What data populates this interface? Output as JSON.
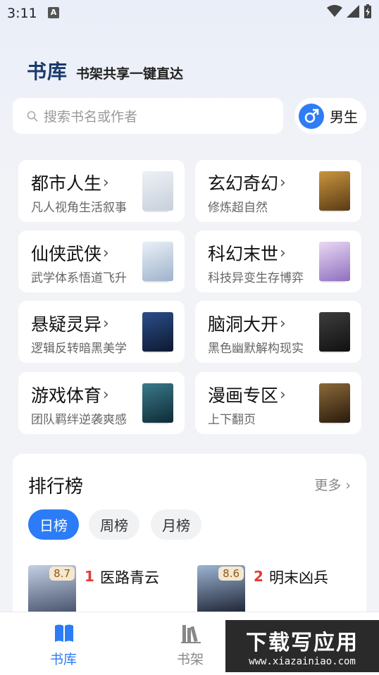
{
  "status": {
    "time": "3:11",
    "notif_icon": "A"
  },
  "header": {
    "title": "书库",
    "subtitle": "书架共享一键直达"
  },
  "search": {
    "placeholder": "搜索书名或作者"
  },
  "gender": {
    "label": "男生",
    "icon": "male-icon"
  },
  "categories": [
    {
      "name": "都市人生",
      "desc": "凡人视角生活叙事",
      "cover_color": "#dde3ea"
    },
    {
      "name": "玄幻奇幻",
      "desc": "修炼超自然",
      "cover_color": "#6a4a26"
    },
    {
      "name": "仙侠武侠",
      "desc": "武学体系悟道飞升",
      "cover_color": "#c9d6e6"
    },
    {
      "name": "科幻末世",
      "desc": "科技异变生存博弈",
      "cover_color": "#b9a6d8"
    },
    {
      "name": "悬疑灵异",
      "desc": "逻辑反转暗黑美学",
      "cover_color": "#1a2a4a"
    },
    {
      "name": "脑洞大开",
      "desc": "黑色幽默解构现实",
      "cover_color": "#2a2a2a"
    },
    {
      "name": "游戏体育",
      "desc": "团队羁绊逆袭爽感",
      "cover_color": "#1f4a5a"
    },
    {
      "name": "漫画专区",
      "desc": "上下翻页",
      "cover_color": "#3a2a1a"
    }
  ],
  "ranking": {
    "title": "排行榜",
    "more": "更多",
    "tabs": [
      {
        "label": "日榜",
        "active": true
      },
      {
        "label": "周榜",
        "active": false
      },
      {
        "label": "月榜",
        "active": false
      }
    ],
    "books": [
      {
        "rank": "1",
        "title": "医路青云",
        "score": "8.7",
        "cover_color": "#6a7a9a"
      },
      {
        "rank": "2",
        "title": "明末凶兵",
        "score": "8.6",
        "cover_color": "#4a5a7a"
      }
    ]
  },
  "nav": {
    "items": [
      {
        "label": "书库",
        "active": true
      },
      {
        "label": "书架",
        "active": false
      }
    ]
  },
  "watermark": {
    "big": "下载写应用",
    "small": "www.xiazainiao.com"
  },
  "colors": {
    "accent": "#2b7cf6",
    "rank_red": "#e23a3a",
    "title_blue": "#1a3a6b"
  }
}
